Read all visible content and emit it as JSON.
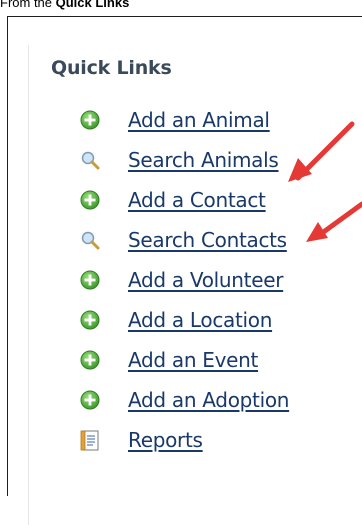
{
  "caption": {
    "prefix": "From the ",
    "bold": "Quick Links"
  },
  "panel": {
    "title": "Quick Links",
    "links": [
      {
        "label": "Add an Animal",
        "icon": "add-icon"
      },
      {
        "label": "Search Animals",
        "icon": "search-icon"
      },
      {
        "label": "Add a Contact",
        "icon": "add-icon"
      },
      {
        "label": "Search Contacts",
        "icon": "search-icon"
      },
      {
        "label": "Add a Volunteer",
        "icon": "add-icon"
      },
      {
        "label": "Add a Location",
        "icon": "add-icon"
      },
      {
        "label": "Add an Event",
        "icon": "add-icon"
      },
      {
        "label": "Add an Adoption",
        "icon": "add-icon"
      },
      {
        "label": "Reports",
        "icon": "report-icon"
      }
    ]
  },
  "colors": {
    "link": "#19396a",
    "title": "#3b4a5a",
    "add_icon": "#4caf50",
    "arrow": "#e53935"
  }
}
